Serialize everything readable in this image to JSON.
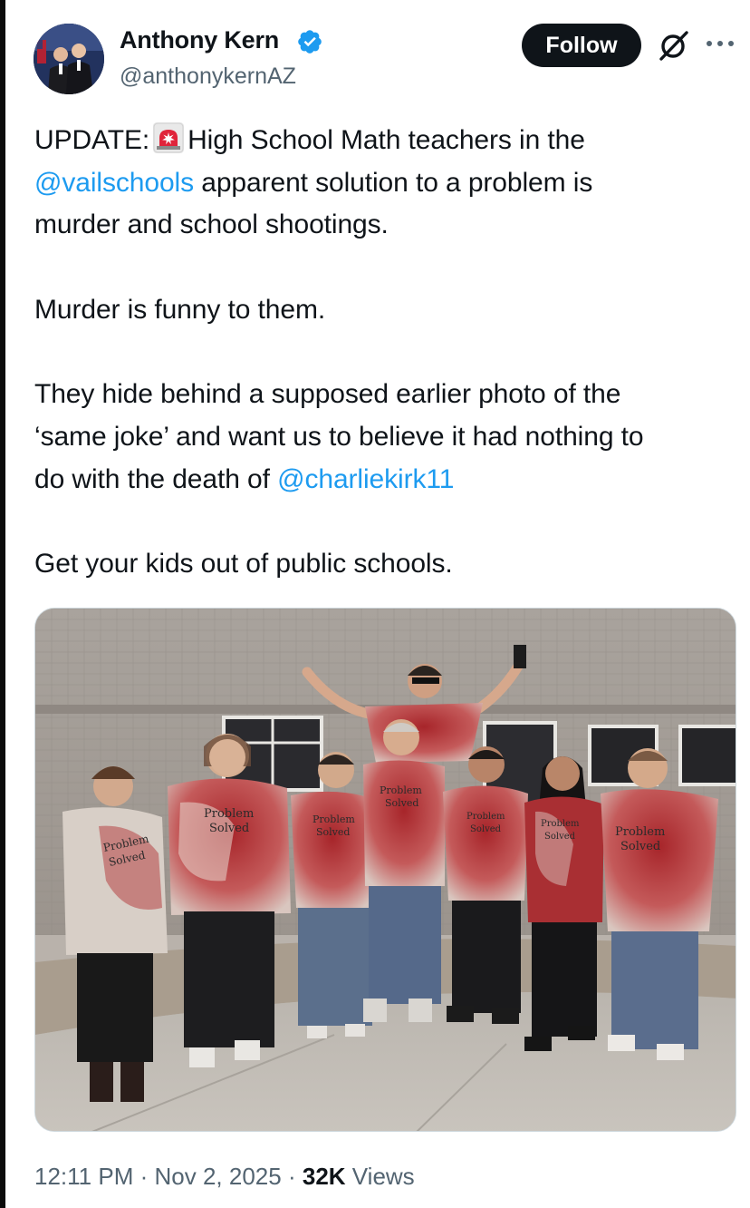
{
  "author": {
    "name": "Anthony Kern",
    "handle": "@anthonykernAZ",
    "verified": true,
    "verified_color": "#1d9bf0"
  },
  "header_actions": {
    "follow_label": "Follow",
    "grok_icon": "grok-icon",
    "more_icon": "more-icon"
  },
  "tweet": {
    "line1_prefix": "UPDATE:",
    "line1_emoji": "police-light-emoji",
    "line1_suffix": "High School Math teachers in the",
    "line2_mention": "@vailschools",
    "line2_rest": "apparent solution to a problem is",
    "line3": "murder and school shootings.",
    "para2": "Murder is funny to them.",
    "para3_line1": "They hide behind a supposed earlier photo of the",
    "para3_line2": "‘same joke’ and want us to believe it had nothing to",
    "para3_line3_prefix": "do with the death of",
    "para3_mention": "@charliekirk11",
    "para4": "Get your kids out of public schools.",
    "mention_color": "#1d9bf0"
  },
  "media": {
    "shirt_text_line1": "Problem",
    "shirt_text_line2": "Solved"
  },
  "meta": {
    "time": "12:11 PM",
    "separator": "·",
    "date": "Nov 2, 2025",
    "views_count": "32K",
    "views_label": "Views"
  }
}
